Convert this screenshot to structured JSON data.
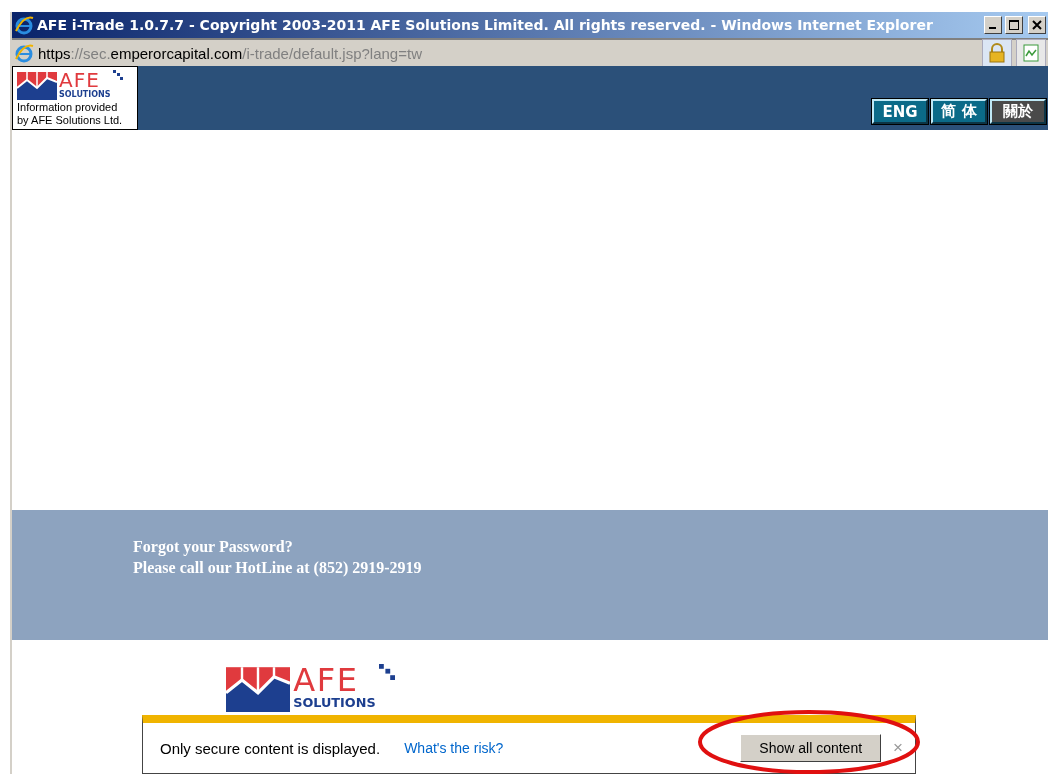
{
  "window": {
    "title": "AFE i-Trade 1.0.7.7 - Copyright 2003-2011 AFE Solutions Limited. All rights reserved. - Windows Internet Explorer"
  },
  "address_bar": {
    "url": [
      {
        "text": "https",
        "strong": true
      },
      {
        "text": "://sec.",
        "strong": false
      },
      {
        "text": "emperorcapital.com",
        "strong": true
      },
      {
        "text": "/i-trade/default.jsp?lang=tw",
        "strong": false
      }
    ]
  },
  "header": {
    "logo": {
      "brand": "AFE",
      "tagline": "SOLUTIONS",
      "caption": [
        "Information provided",
        "by AFE Solutions Ltd."
      ]
    },
    "languages": [
      {
        "label": "ENG",
        "color": "#0b6a88"
      },
      {
        "label": "简 体",
        "color": "#0b6a88"
      },
      {
        "label": "關於",
        "color": "#4a4a4a"
      }
    ]
  },
  "help_band": {
    "lines": [
      "Forgot your Password?",
      "Please call our HotLine at (852) 2919-2919"
    ]
  },
  "footer": {
    "logo": {
      "brand": "AFE",
      "tagline": "SOLUTIONS"
    }
  },
  "notification": {
    "message": "Only secure content is displayed.",
    "link": "What's the risk?",
    "button": "Show all content",
    "close": "×"
  }
}
